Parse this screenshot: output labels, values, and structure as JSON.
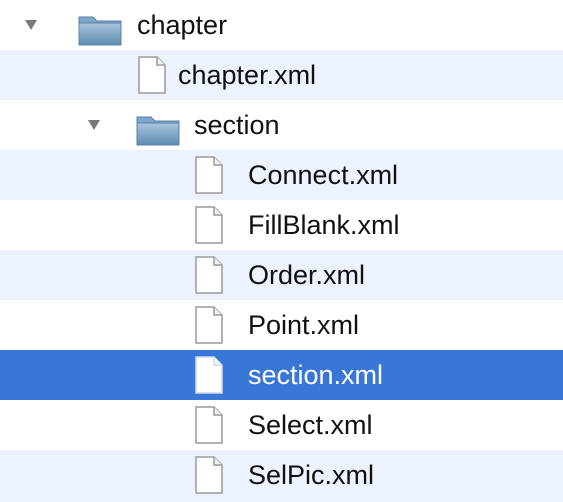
{
  "tree": {
    "items": [
      {
        "label": "chapter",
        "kind": "folder",
        "expanded": true,
        "icon": "folder-icon"
      },
      {
        "label": "chapter.xml",
        "kind": "file",
        "icon": "document-icon"
      },
      {
        "label": "section",
        "kind": "folder",
        "expanded": true,
        "icon": "folder-icon"
      },
      {
        "label": "Connect.xml",
        "kind": "file",
        "icon": "document-icon"
      },
      {
        "label": "FillBlank.xml",
        "kind": "file",
        "icon": "document-icon"
      },
      {
        "label": "Order.xml",
        "kind": "file",
        "icon": "document-icon"
      },
      {
        "label": "Point.xml",
        "kind": "file",
        "icon": "document-icon"
      },
      {
        "label": "section.xml",
        "kind": "file",
        "selected": true,
        "icon": "document-icon"
      },
      {
        "label": "Select.xml",
        "kind": "file",
        "icon": "document-icon"
      },
      {
        "label": "SelPic.xml",
        "kind": "file",
        "icon": "document-icon"
      }
    ]
  },
  "colors": {
    "selection": "#3876d8",
    "alternate_row": "#edf3fe",
    "folder": "#7fa7c9"
  }
}
